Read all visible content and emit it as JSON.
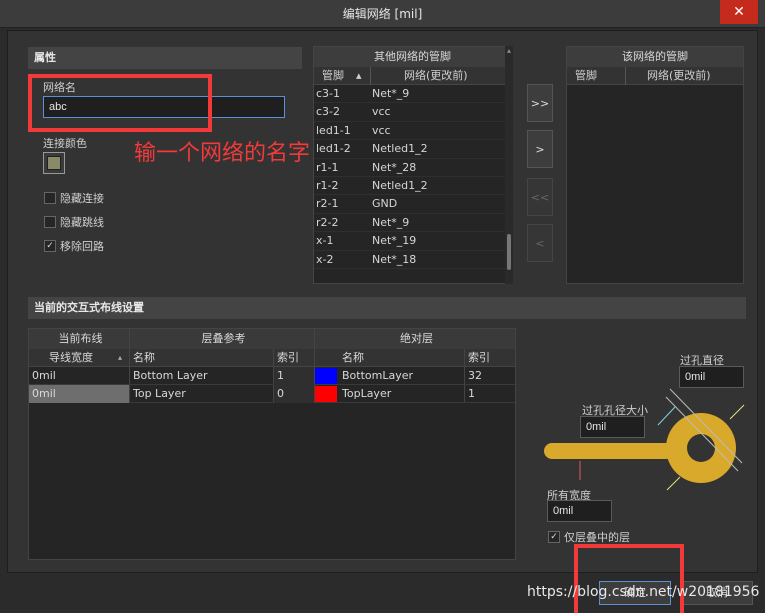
{
  "window": {
    "title": "编辑网络 [mil]",
    "close_glyph": "✕"
  },
  "properties": {
    "header": "属性",
    "net_name_label": "网络名",
    "net_name_value": "abc",
    "color_label": "连接颜色",
    "color_swatch": "#8a8a6a",
    "checkboxes": [
      {
        "label": "隐藏连接",
        "checked": false
      },
      {
        "label": "隐藏跳线",
        "checked": false
      },
      {
        "label": "移除回路",
        "checked": true
      }
    ]
  },
  "other_pins": {
    "header": "其他网络的管脚",
    "col_pin": "管脚",
    "col_net": "网络(更改前)",
    "rows": [
      {
        "pin": "c3-1",
        "net": "Net*_9"
      },
      {
        "pin": "c3-2",
        "net": "vcc"
      },
      {
        "pin": "led1-1",
        "net": "vcc"
      },
      {
        "pin": "led1-2",
        "net": "Netled1_2"
      },
      {
        "pin": "r1-1",
        "net": "Net*_28"
      },
      {
        "pin": "r1-2",
        "net": "Netled1_2"
      },
      {
        "pin": "r2-1",
        "net": "GND"
      },
      {
        "pin": "r2-2",
        "net": "Net*_9"
      },
      {
        "pin": "x-1",
        "net": "Net*_19"
      },
      {
        "pin": "x-2",
        "net": "Net*_18"
      }
    ]
  },
  "transfer_buttons": {
    "all_right": ">>",
    "right": ">",
    "all_left": "<<",
    "left": "<"
  },
  "this_pins": {
    "header": "该网络的管脚",
    "col_pin": "管脚",
    "col_net": "网络(更改前)"
  },
  "routing": {
    "header": "当前的交互式布线设置",
    "group_current": "当前布线",
    "group_stack": "层叠参考",
    "group_abs": "绝对层",
    "col_width": "导线宽度",
    "col_name": "名称",
    "col_index": "索引",
    "col_abs_name": "名称",
    "col_abs_index": "索引",
    "rows": [
      {
        "width": "0mil",
        "name": "Bottom Layer",
        "index": "1",
        "color": "#0000ff",
        "abs_name": "BottomLayer",
        "abs_index": "32"
      },
      {
        "width": "0mil",
        "name": "Top Layer",
        "index": "0",
        "color": "#ff0000",
        "abs_name": "TopLayer",
        "abs_index": "1"
      }
    ]
  },
  "via": {
    "diameter_label": "过孔直径",
    "diameter_value": "0mil",
    "hole_label": "过孔孔径大小",
    "hole_value": "0mil",
    "all_width_label": "所有宽度",
    "all_width_value": "0mil",
    "stack_only_label": "仅层叠中的层",
    "stack_only_checked": true
  },
  "footer": {
    "ok_label": "确定",
    "cancel_label": "取消",
    "watermark": "https://blog.csdn.net/w20181956"
  },
  "annotation": {
    "text": "输一个网络的名字"
  },
  "colors": {
    "accent_red": "#f23a3a",
    "via_gold": "#d9a92b"
  }
}
